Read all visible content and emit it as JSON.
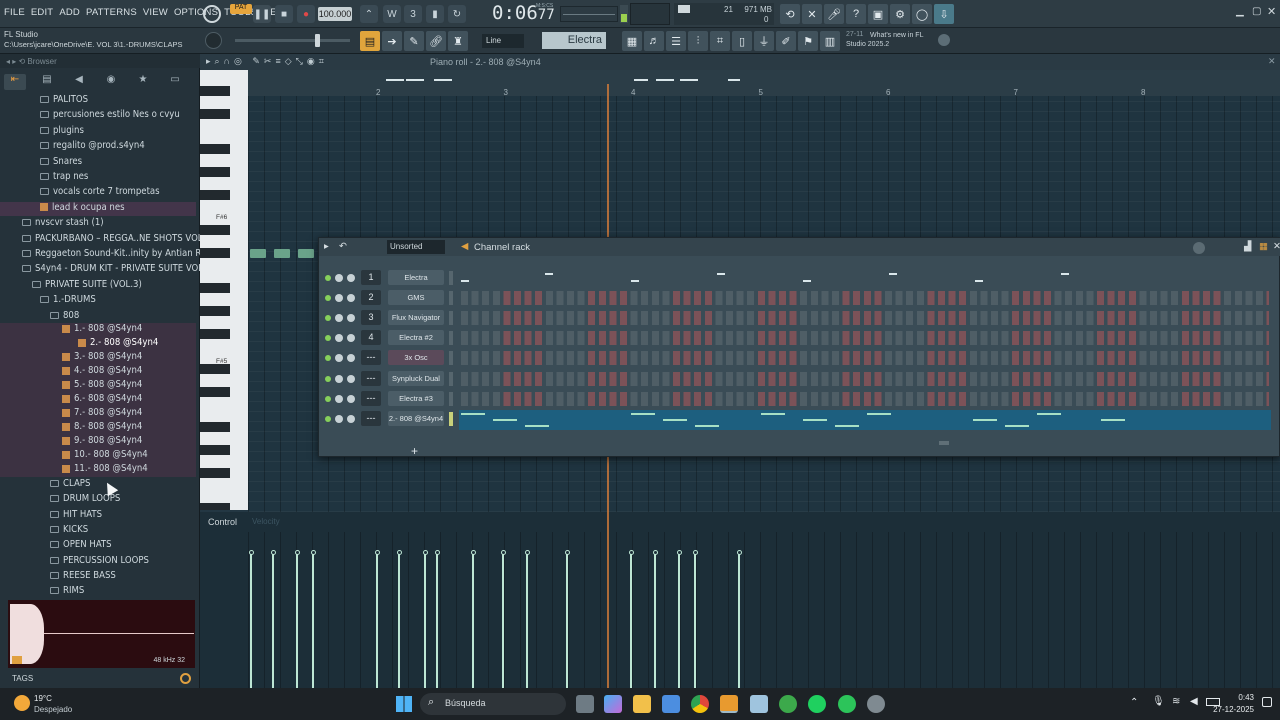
{
  "menu": [
    "FILE",
    "EDIT",
    "ADD",
    "PATTERNS",
    "VIEW",
    "OPTIONS",
    "TOOLS",
    "HELP"
  ],
  "transport": {
    "pattern_badge": "PAT",
    "tempo": "100.000",
    "time": "0:06",
    "time_sub": "77",
    "time_caption": "M:S:CS"
  },
  "memory": {
    "cpu": "21",
    "ram": "971 MB",
    "voices": "0"
  },
  "news": {
    "date": "27-11",
    "text": "What's new in FL Studio 2025.2"
  },
  "app": {
    "title": "FL Studio",
    "path": "C:\\Users\\jcare\\OneDrive\\E. VOL 3\\1.-DRUMS\\CLAPS"
  },
  "toolbar2": {
    "snap": "Line",
    "channel": "Electra"
  },
  "browser": {
    "title": "Browser",
    "items": [
      {
        "label": "PALITOS",
        "indent": 40,
        "type": "folder"
      },
      {
        "label": "percusiones estilo Nes o cvyu",
        "indent": 40,
        "type": "folder"
      },
      {
        "label": "plugins",
        "indent": 40,
        "type": "folder"
      },
      {
        "label": "regalito @prod.s4yn4",
        "indent": 40,
        "type": "folder"
      },
      {
        "label": "Snares",
        "indent": 40,
        "type": "folder"
      },
      {
        "label": "trap nes",
        "indent": 40,
        "type": "folder"
      },
      {
        "label": "vocals corte 7 trompetas",
        "indent": 40,
        "type": "folder"
      },
      {
        "label": "lead k ocupa nes",
        "indent": 40,
        "type": "audio",
        "selected": true
      },
      {
        "label": "nvscvr stash (1)",
        "indent": 22,
        "type": "folder"
      },
      {
        "label": "PACKURBANO – REGGA..NE SHOTS VOL. 03",
        "indent": 22,
        "type": "folder"
      },
      {
        "label": "Reggaeton Sound-Kit..inity by Antian Rose",
        "indent": 22,
        "type": "folder"
      },
      {
        "label": "S4yn4 - DRUM KIT - PRIVATE SUITE VOL.3",
        "indent": 22,
        "type": "folder"
      },
      {
        "label": "PRIVATE SUITE (VOL.3)",
        "indent": 32,
        "type": "folder"
      },
      {
        "label": "1.-DRUMS",
        "indent": 40,
        "type": "folder"
      },
      {
        "label": "808",
        "indent": 50,
        "type": "folder"
      }
    ],
    "samples": [
      "1.- 808 @S4yn4",
      "2.- 808 @S4yn4",
      "3.- 808 @S4yn4",
      "4.- 808 @S4yn4",
      "5.- 808 @S4yn4",
      "6.- 808 @S4yn4",
      "7.- 808 @S4yn4",
      "8.- 808 @S4yn4",
      "9.- 808 @S4yn4",
      "10.- 808 @S4yn4",
      "11.- 808 @S4yn4"
    ],
    "subfolders": [
      "CLAPS",
      "DRUM LOOPS",
      "HIT HATS",
      "KICKS",
      "OPEN HATS",
      "PERCUSSION LOOPS",
      "REESE BASS",
      "RIMS"
    ],
    "preview_info": "48 kHz 32",
    "tags_label": "TAGS"
  },
  "pianoroll": {
    "title": "Piano roll - 2.- 808 @S4yn4",
    "bars": [
      "2",
      "3",
      "4",
      "5",
      "6",
      "7",
      "8"
    ],
    "key_labels": [
      "F#6",
      "F#5"
    ],
    "control_label": "Control",
    "velocity_label": "Velocity"
  },
  "channelrack": {
    "title": "Channel rack",
    "filter": "Unsorted",
    "channels": [
      {
        "num": "1",
        "name": "Electra",
        "highlight": false
      },
      {
        "num": "2",
        "name": "GMS",
        "highlight": false
      },
      {
        "num": "3",
        "name": "Flux Navigator",
        "highlight": false
      },
      {
        "num": "4",
        "name": "Electra #2",
        "highlight": false
      },
      {
        "num": "---",
        "name": "3x Osc",
        "highlight": true
      },
      {
        "num": "---",
        "name": "Synpluck Dual",
        "highlight": false
      },
      {
        "num": "---",
        "name": "Electra #3",
        "highlight": false
      },
      {
        "num": "---",
        "name": "2.- 808 @S4yn4",
        "highlight": false
      }
    ],
    "add_label": "+"
  },
  "taskbar": {
    "weather_temp": "19°C",
    "weather_desc": "Despejado",
    "search": "Búsqueda",
    "time": "0:43",
    "date": "27-12-2025"
  },
  "colors": {
    "accent": "#d27b3a",
    "grid": "#1f3440",
    "steps_red": "#7c5258",
    "green": "#86d05b"
  }
}
